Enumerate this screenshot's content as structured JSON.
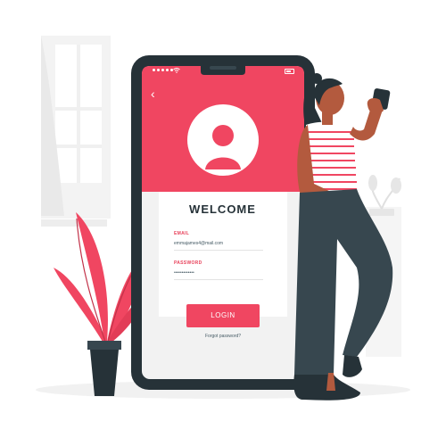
{
  "colors": {
    "accent": "#F04661",
    "dark": "#263238",
    "skin": "#B35A3E",
    "background_light": "#F2F2F2"
  },
  "illustration": {
    "phone": "smartphone",
    "person": "woman-holding-phone",
    "plant": "potted-plant",
    "window": "window-with-curtain",
    "small_plant": "small-plant-pot"
  },
  "status_bar": {
    "signal_icon": "signal-dots-icon",
    "wifi_icon": "wifi-icon",
    "battery_icon": "battery-icon"
  },
  "login": {
    "back_icon": "back-arrow-icon",
    "avatar_icon": "user-avatar-icon",
    "title": "WELCOME",
    "email_label": "EMAIL",
    "email_value": "emmajames4@mail.com",
    "password_label": "PASSWORD",
    "password_value": "•••••••••••••",
    "button_label": "LOGIN",
    "forgot_label": "Forgot password?"
  }
}
